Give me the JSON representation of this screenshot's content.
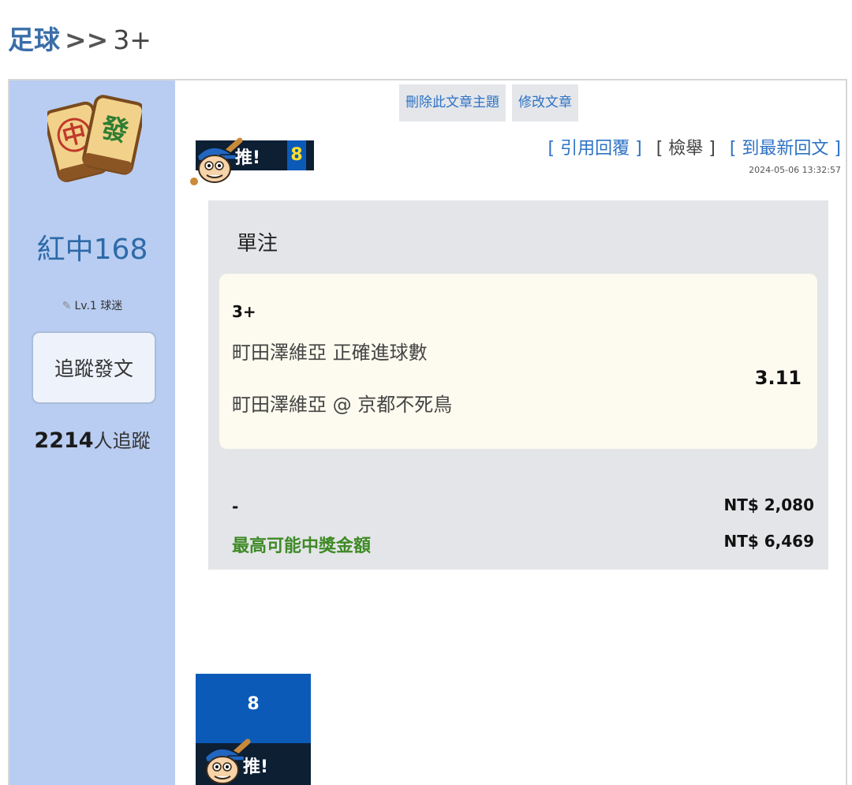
{
  "header": {
    "section": "足球",
    "separator": ">>",
    "topic": "3+"
  },
  "author": {
    "name": "紅中168",
    "level": "Lv.1 球迷",
    "follow_button": "追蹤發文",
    "followers_count": "2214",
    "followers_suffix": "人追蹤",
    "avatar_text": {
      "left": "中",
      "right": "發"
    }
  },
  "admin": {
    "delete_label": "刪除此文章主題",
    "edit_label": "修改文章"
  },
  "push": {
    "label": "推!",
    "count": "8"
  },
  "actions": {
    "quote_reply": "[ 引用回覆 ]",
    "report": "[ 檢舉 ]",
    "latest_reply": "[ 到最新回文 ]",
    "timestamp": "2024-05-06 13:32:57"
  },
  "bet": {
    "type": "單注",
    "pick": "3+",
    "market": "町田澤維亞 正確進球數",
    "match": "町田澤維亞 @ 京都不死鳥",
    "odds": "3.11",
    "stake_label": "-",
    "stake_amount": "NT$ 2,080",
    "payout_label": "最高可能中獎金額",
    "payout_amount": "NT$ 6,469"
  },
  "colors": {
    "sidebar": "#b9cdf2",
    "link": "#2d72c4",
    "push_blue": "#0b5ab8",
    "push_dark": "#0d1f33",
    "payout_green": "#3e8a26"
  }
}
